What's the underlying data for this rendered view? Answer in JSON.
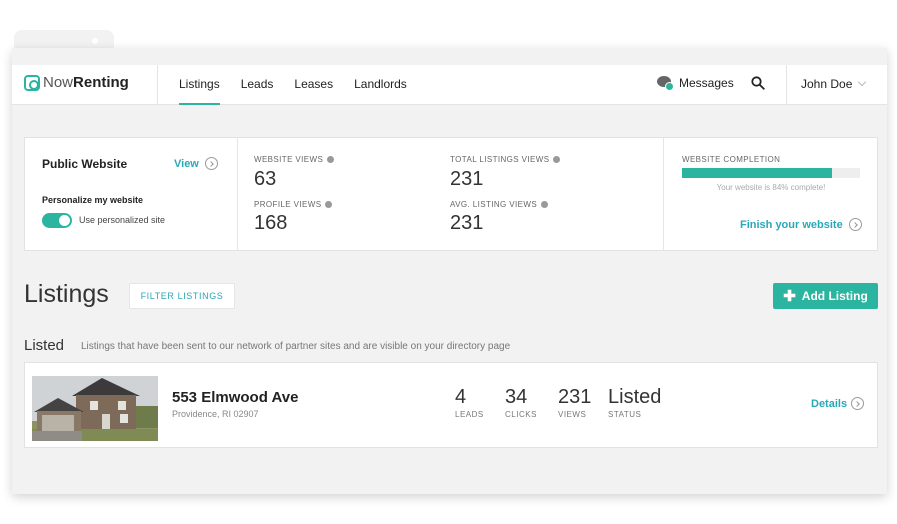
{
  "app": {
    "logo_now": "Now",
    "logo_renting": "Renting"
  },
  "nav": {
    "items": [
      {
        "label": "Listings",
        "active": true
      },
      {
        "label": "Leads",
        "active": false
      },
      {
        "label": "Leases",
        "active": false
      },
      {
        "label": "Landlords",
        "active": false
      }
    ],
    "messages_label": "Messages",
    "messages_badge": "1",
    "user_name": "John Doe"
  },
  "public_website": {
    "title": "Public Website",
    "view_label": "View",
    "personalize_label": "Personalize my website",
    "toggle_on": true,
    "toggle_label": "Use personalized site"
  },
  "stats": {
    "website_views_label": "WEBSITE VIEWS",
    "website_views": "63",
    "profile_views_label": "PROFILE VIEWS",
    "profile_views": "168",
    "total_listings_views_label": "TOTAL LISTINGS VIEWS",
    "total_listings_views": "231",
    "avg_listing_views_label": "AVG. LISTING VIEWS",
    "avg_listing_views": "231"
  },
  "completion": {
    "label": "WEBSITE COMPLETION",
    "percent": 84,
    "caption": "Your website is 84% complete!",
    "finish_label": "Finish your website"
  },
  "listings": {
    "title": "Listings",
    "filter_label": "FILTER LISTINGS",
    "add_label": "Add Listing",
    "section_title": "Listed",
    "section_desc": "Listings that have been sent to our network of partner sites and are visible on your directory page",
    "items": [
      {
        "address": "553 Elmwood Ave",
        "city": "Providence, RI 02907",
        "leads": "4",
        "leads_label": "LEADS",
        "clicks": "34",
        "clicks_label": "CLICKS",
        "views": "231",
        "views_label": "VIEWS",
        "status": "Listed",
        "status_label": "STATUS",
        "details_label": "Details"
      }
    ]
  },
  "colors": {
    "accent": "#2bb5a0",
    "link": "#2aa8b8"
  }
}
